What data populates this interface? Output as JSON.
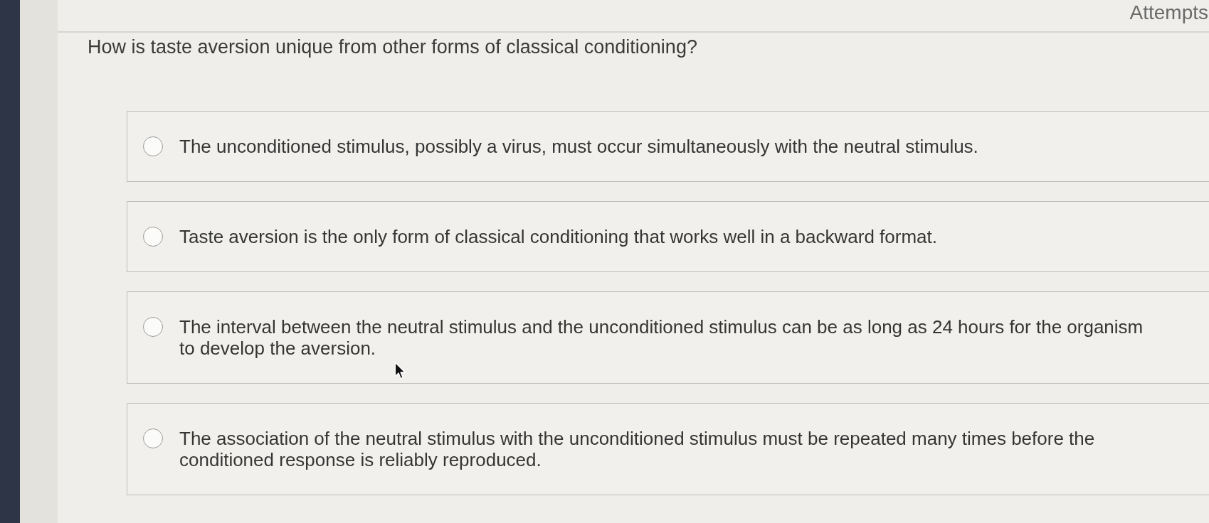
{
  "header": {
    "attempts_label": "Attempts"
  },
  "question": {
    "text": "How is taste aversion unique from other forms of classical conditioning?"
  },
  "options": [
    {
      "text": "The unconditioned stimulus, possibly a virus, must occur simultaneously with the neutral stimulus.",
      "selected": false
    },
    {
      "text": "Taste aversion is the only form of classical conditioning that works well in a backward format.",
      "selected": false
    },
    {
      "text": "The interval between the neutral stimulus and the unconditioned stimulus can be as long as 24 hours for the organism to develop the aversion.",
      "selected": false
    },
    {
      "text": "The association of the neutral stimulus with the unconditioned stimulus must be repeated many times before the conditioned response is reliably reproduced.",
      "selected": false
    }
  ]
}
